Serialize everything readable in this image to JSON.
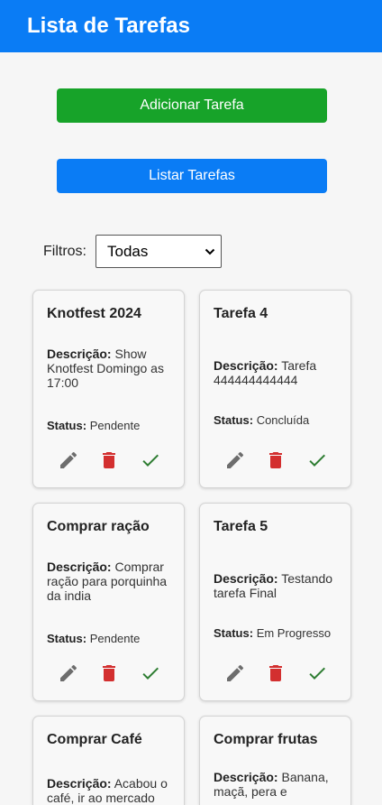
{
  "header": {
    "title": "Lista de Tarefas"
  },
  "buttons": {
    "add_label": "Adicionar Tarefa",
    "list_label": "Listar Tarefas"
  },
  "filter": {
    "label": "Filtros:",
    "selected": "Todas"
  },
  "labels": {
    "description": "Descrição:",
    "status": "Status:"
  },
  "colors": {
    "header": "#0a7cf5",
    "add_button": "#17a329",
    "edit_icon": "#6d6d6d",
    "delete_icon": "#d32f2f",
    "done_icon": "#2e7d32"
  },
  "tasks": [
    {
      "title": "Knotfest 2024",
      "description": "Show Knotfest Domingo as 17:00",
      "status": "Pendente"
    },
    {
      "title": "Tarefa 4",
      "description": "Tarefa 444444444444",
      "status": "Concluída"
    },
    {
      "title": "Comprar ração",
      "description": "Comprar ração para porquinha da india",
      "status": "Pendente"
    },
    {
      "title": "Tarefa 5",
      "description": "Testando tarefa Final",
      "status": "Em Progresso"
    },
    {
      "title": "Comprar Café",
      "description": "Acabou o café, ir ao mercado",
      "status": ""
    },
    {
      "title": "Comprar frutas",
      "description": "Banana, maçã, pera e",
      "status": ""
    }
  ]
}
